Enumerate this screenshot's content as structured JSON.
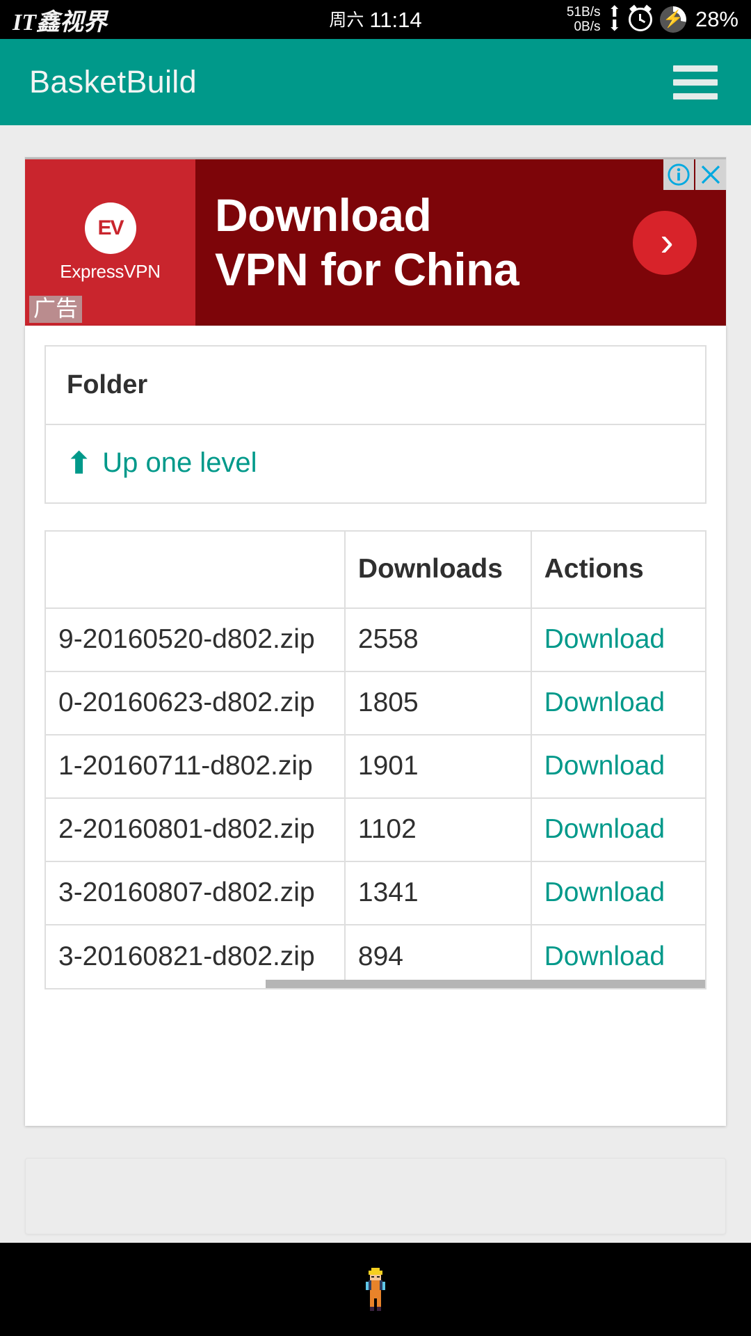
{
  "statusbar": {
    "watermark": "IT鑫视界",
    "day_of_week": "周六",
    "time": "11:14",
    "net_down": "51B/s",
    "net_up": "0B/s",
    "up_arrow_icon": "arrow-up-icon",
    "down_arrow_icon": "arrow-down-icon",
    "alarm_icon": "alarm-clock-icon",
    "battery_icon": "battery-charging-icon",
    "battery_percent": "28%"
  },
  "appbar": {
    "title": "BasketBuild",
    "menu_icon": "hamburger-menu-icon",
    "background": "#00998a"
  },
  "ad": {
    "advertiser": "ExpressVPN",
    "logo_text": "EV",
    "headline_line1": "Download",
    "headline_line2": "VPN for China",
    "cta_icon": "chevron-right-icon",
    "info_icon": "adchoices-info-icon",
    "close_icon": "close-x-icon",
    "label": "广告",
    "left_bg": "#c9252d",
    "right_bg": "#7d0509",
    "cta_bg": "#d8232a",
    "badge_icon_color": "#00a9e0"
  },
  "folder_panel": {
    "header": "Folder",
    "up_one_level": "Up one level",
    "up_arrow_icon": "arrow-up-icon",
    "link_color": "#00998a"
  },
  "files_table": {
    "columns": [
      "",
      "Downloads",
      "Actions"
    ],
    "rows": [
      {
        "name": "9-20160520-d802.zip",
        "downloads": "2558",
        "action": "Download"
      },
      {
        "name": "0-20160623-d802.zip",
        "downloads": "1805",
        "action": "Download"
      },
      {
        "name": "1-20160711-d802.zip",
        "downloads": "1901",
        "action": "Download"
      },
      {
        "name": "2-20160801-d802.zip",
        "downloads": "1102",
        "action": "Download"
      },
      {
        "name": "3-20160807-d802.zip",
        "downloads": "1341",
        "action": "Download"
      },
      {
        "name": "3-20160821-d802.zip",
        "downloads": "894",
        "action": "Download"
      }
    ],
    "horizontal_scrollbar": true
  },
  "navbar": {
    "home_indicator_icon": "pixel-character-icon"
  }
}
